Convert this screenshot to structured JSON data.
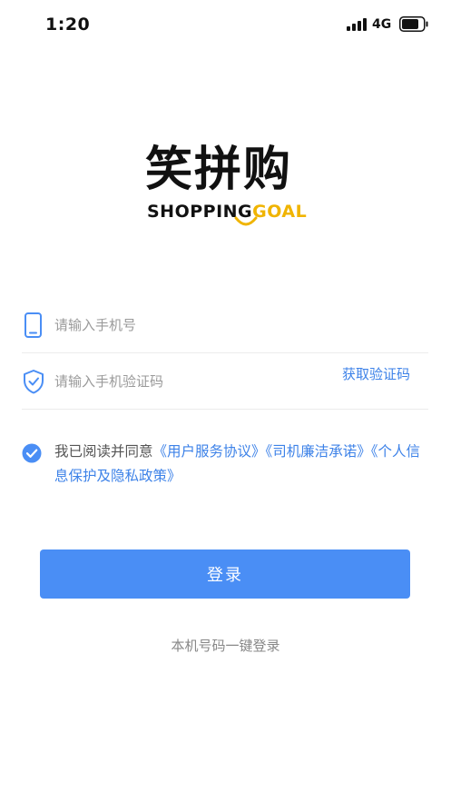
{
  "status_bar": {
    "time": "1:20",
    "network": "4G"
  },
  "logo": {
    "name_cn": "笑拼购",
    "name_en_dark": "SHOPPING",
    "name_en_gold": "GOAL"
  },
  "form": {
    "phone_placeholder": "请输入手机号",
    "code_placeholder": "请输入手机验证码",
    "get_code_label": "获取验证码"
  },
  "agreement": {
    "checked": true,
    "prefix": "我已阅读并同意",
    "links": [
      "《用户服务协议》",
      "《司机廉洁承诺》",
      "《个人信息保护及隐私政策》"
    ]
  },
  "actions": {
    "login_label": "登录",
    "one_click_login_label": "本机号码一键登录"
  },
  "colors": {
    "primary": "#4a8ef5",
    "link": "#3d82e8",
    "logo_gold": "#f0b400"
  }
}
